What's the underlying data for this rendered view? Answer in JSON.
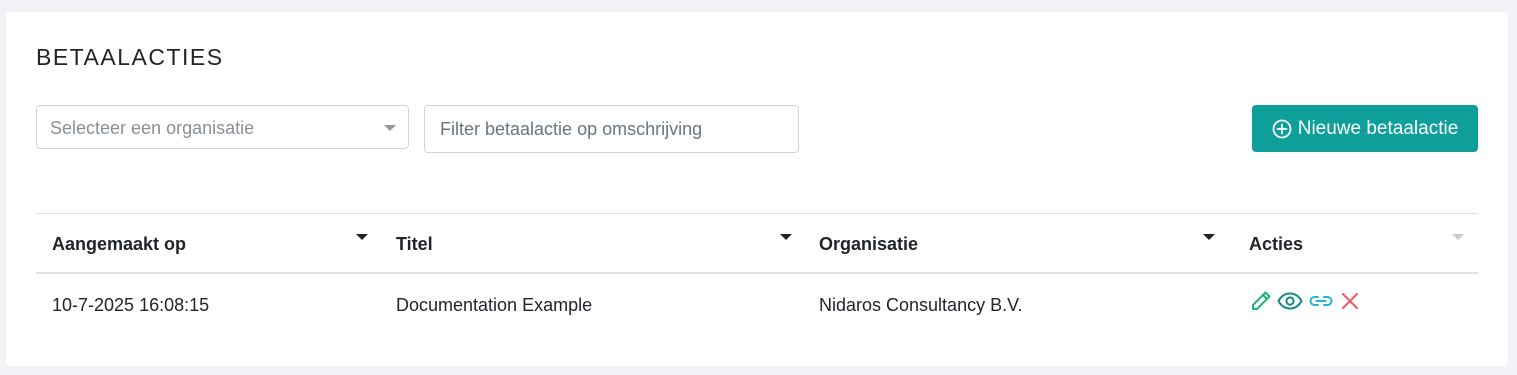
{
  "page": {
    "title": "BETAALACTIES"
  },
  "toolbar": {
    "org_select_placeholder": "Selecteer een organisatie",
    "filter_placeholder": "Filter betaalactie op omschrijving",
    "new_button_label": "Nieuwe betaalactie",
    "new_button_icon": "plus-circle-icon"
  },
  "table": {
    "columns": [
      "Aangemaakt op",
      "Titel",
      "Organisatie",
      "Acties"
    ],
    "rows": [
      {
        "created": "10-7-2025 16:08:15",
        "title": "Documentation Example",
        "organisation": "Nidaros Consultancy B.V.",
        "actions": [
          "pencil-icon",
          "eye-icon",
          "link-icon",
          "close-icon"
        ]
      }
    ]
  },
  "colors": {
    "accent": "#0e9f9b",
    "edit": "#1fb57a",
    "view": "#138c85",
    "link": "#1fb6d4",
    "delete": "#f0626b"
  }
}
